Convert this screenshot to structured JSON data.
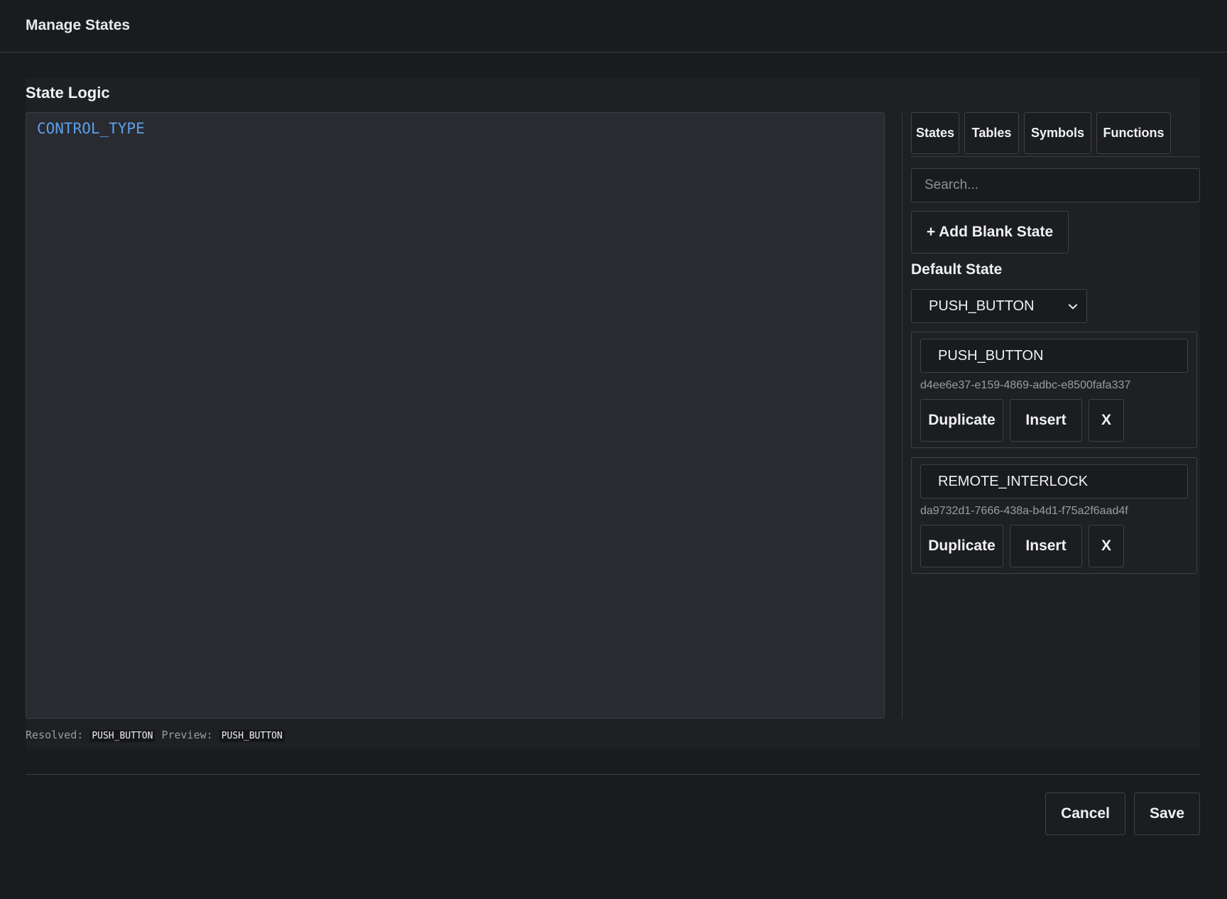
{
  "dialog": {
    "title": "Manage States"
  },
  "logic": {
    "section_title": "State Logic",
    "editor_text": "CONTROL_TYPE",
    "resolved_label": "Resolved:",
    "resolved_value": "PUSH_BUTTON",
    "preview_label": "Preview:",
    "preview_value": "PUSH_BUTTON"
  },
  "sidebar": {
    "tabs": [
      {
        "label": "States"
      },
      {
        "label": "Tables"
      },
      {
        "label": "Symbols"
      },
      {
        "label": "Functions"
      }
    ],
    "search_placeholder": "Search...",
    "add_button": "+ Add Blank State",
    "default_state_label": "Default State",
    "default_state_value": "PUSH_BUTTON",
    "states": [
      {
        "name": "PUSH_BUTTON",
        "id": "d4ee6e37-e159-4869-adbc-e8500fafa337",
        "duplicate": "Duplicate",
        "insert": "Insert",
        "remove": "X"
      },
      {
        "name": "REMOTE_INTERLOCK",
        "id": "da9732d1-7666-438a-b4d1-f75a2f6aad4f",
        "duplicate": "Duplicate",
        "insert": "Insert",
        "remove": "X"
      }
    ]
  },
  "footer": {
    "cancel": "Cancel",
    "save": "Save"
  }
}
